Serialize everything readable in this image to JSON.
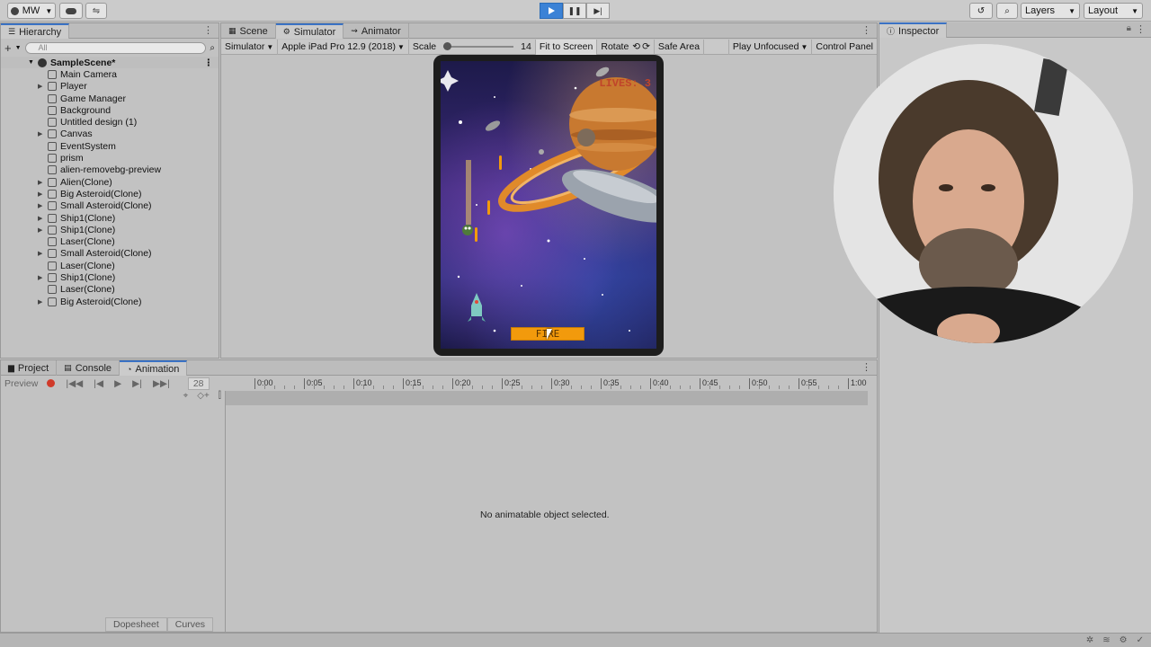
{
  "toolbar": {
    "account": "MW",
    "layers_label": "Layers",
    "layout_label": "Layout"
  },
  "hierarchy": {
    "tab_label": "Hierarchy",
    "search_placeholder": "All",
    "scene_name": "SampleScene*",
    "items": [
      {
        "label": "Main Camera",
        "expandable": false
      },
      {
        "label": "Player",
        "expandable": true
      },
      {
        "label": "Game Manager",
        "expandable": false
      },
      {
        "label": "Background",
        "expandable": false
      },
      {
        "label": "Untitled design (1)",
        "expandable": false
      },
      {
        "label": "Canvas",
        "expandable": true
      },
      {
        "label": "EventSystem",
        "expandable": false
      },
      {
        "label": "prism",
        "expandable": false
      },
      {
        "label": "alien-removebg-preview",
        "expandable": false
      },
      {
        "label": "Alien(Clone)",
        "expandable": true
      },
      {
        "label": "Big Asteroid(Clone)",
        "expandable": true
      },
      {
        "label": "Small Asteroid(Clone)",
        "expandable": true
      },
      {
        "label": "Ship1(Clone)",
        "expandable": true
      },
      {
        "label": "Ship1(Clone)",
        "expandable": true
      },
      {
        "label": "Laser(Clone)",
        "expandable": false
      },
      {
        "label": "Small Asteroid(Clone)",
        "expandable": true
      },
      {
        "label": "Laser(Clone)",
        "expandable": false
      },
      {
        "label": "Ship1(Clone)",
        "expandable": true
      },
      {
        "label": "Laser(Clone)",
        "expandable": false
      },
      {
        "label": "Big Asteroid(Clone)",
        "expandable": true
      }
    ]
  },
  "center": {
    "tabs": [
      "Scene",
      "Simulator",
      "Animator"
    ],
    "active_tab": "Simulator",
    "sim_bar": {
      "mode": "Simulator",
      "device": "Apple iPad Pro 12.9 (2018)",
      "scale_label": "Scale",
      "scale_value": "14",
      "fit_to_screen": "Fit to Screen",
      "rotate": "Rotate",
      "safe_area": "Safe Area",
      "play_unfocused": "Play Unfocused",
      "control_panel": "Control Panel"
    },
    "game": {
      "lives_text": "LIVES: 3",
      "fire_button": "FIRE"
    }
  },
  "inspector": {
    "tab_label": "Inspector"
  },
  "bottom": {
    "tabs": [
      "Project",
      "Console",
      "Animation"
    ],
    "active_tab": "Animation",
    "preview_label": "Preview",
    "frame_value": "28",
    "timeline_ticks": [
      "0:00",
      "0:05",
      "0:10",
      "0:15",
      "0:20",
      "0:25",
      "0:30",
      "0:35",
      "0:40",
      "0:45",
      "0:50",
      "0:55",
      "1:00"
    ],
    "dopesheet": "Dopesheet",
    "curves": "Curves",
    "empty_message": "No animatable object selected."
  },
  "colors": {
    "accent": "#3b82d6",
    "fire_button": "#f29a0c",
    "lives_text": "#c0452a"
  }
}
